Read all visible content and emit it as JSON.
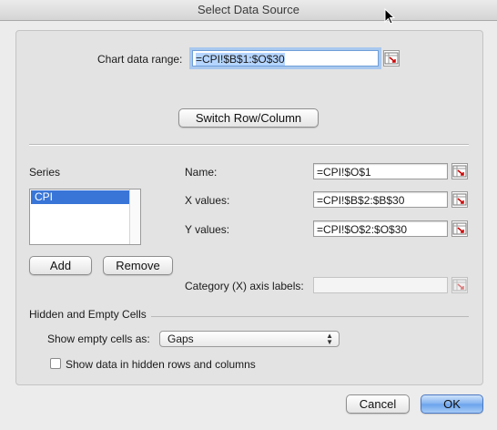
{
  "window": {
    "title": "Select Data Source"
  },
  "chart_range": {
    "label": "Chart data range:",
    "value": "=CPI!$B$1:$O$30"
  },
  "switch_button": "Switch Row/Column",
  "series": {
    "label": "Series",
    "items": [
      "CPI"
    ],
    "name_label": "Name:",
    "name_value": "=CPI!$O$1",
    "x_label": "X values:",
    "x_value": "=CPI!$B$2:$B$30",
    "y_label": "Y values:",
    "y_value": "=CPI!$O$2:$O$30",
    "add_label": "Add",
    "remove_label": "Remove",
    "category_label": "Category (X) axis labels:",
    "category_value": ""
  },
  "hidden_empty": {
    "title": "Hidden and Empty Cells",
    "show_empty_label": "Show empty cells as:",
    "show_empty_value": "Gaps",
    "show_hidden_label": "Show data in hidden rows and columns",
    "show_hidden_checked": false
  },
  "buttons": {
    "cancel": "Cancel",
    "ok": "OK"
  },
  "colors": {
    "accent": "#3875d7",
    "selection": "#b5d5ff",
    "focus_ring": "#a9c8ee"
  }
}
